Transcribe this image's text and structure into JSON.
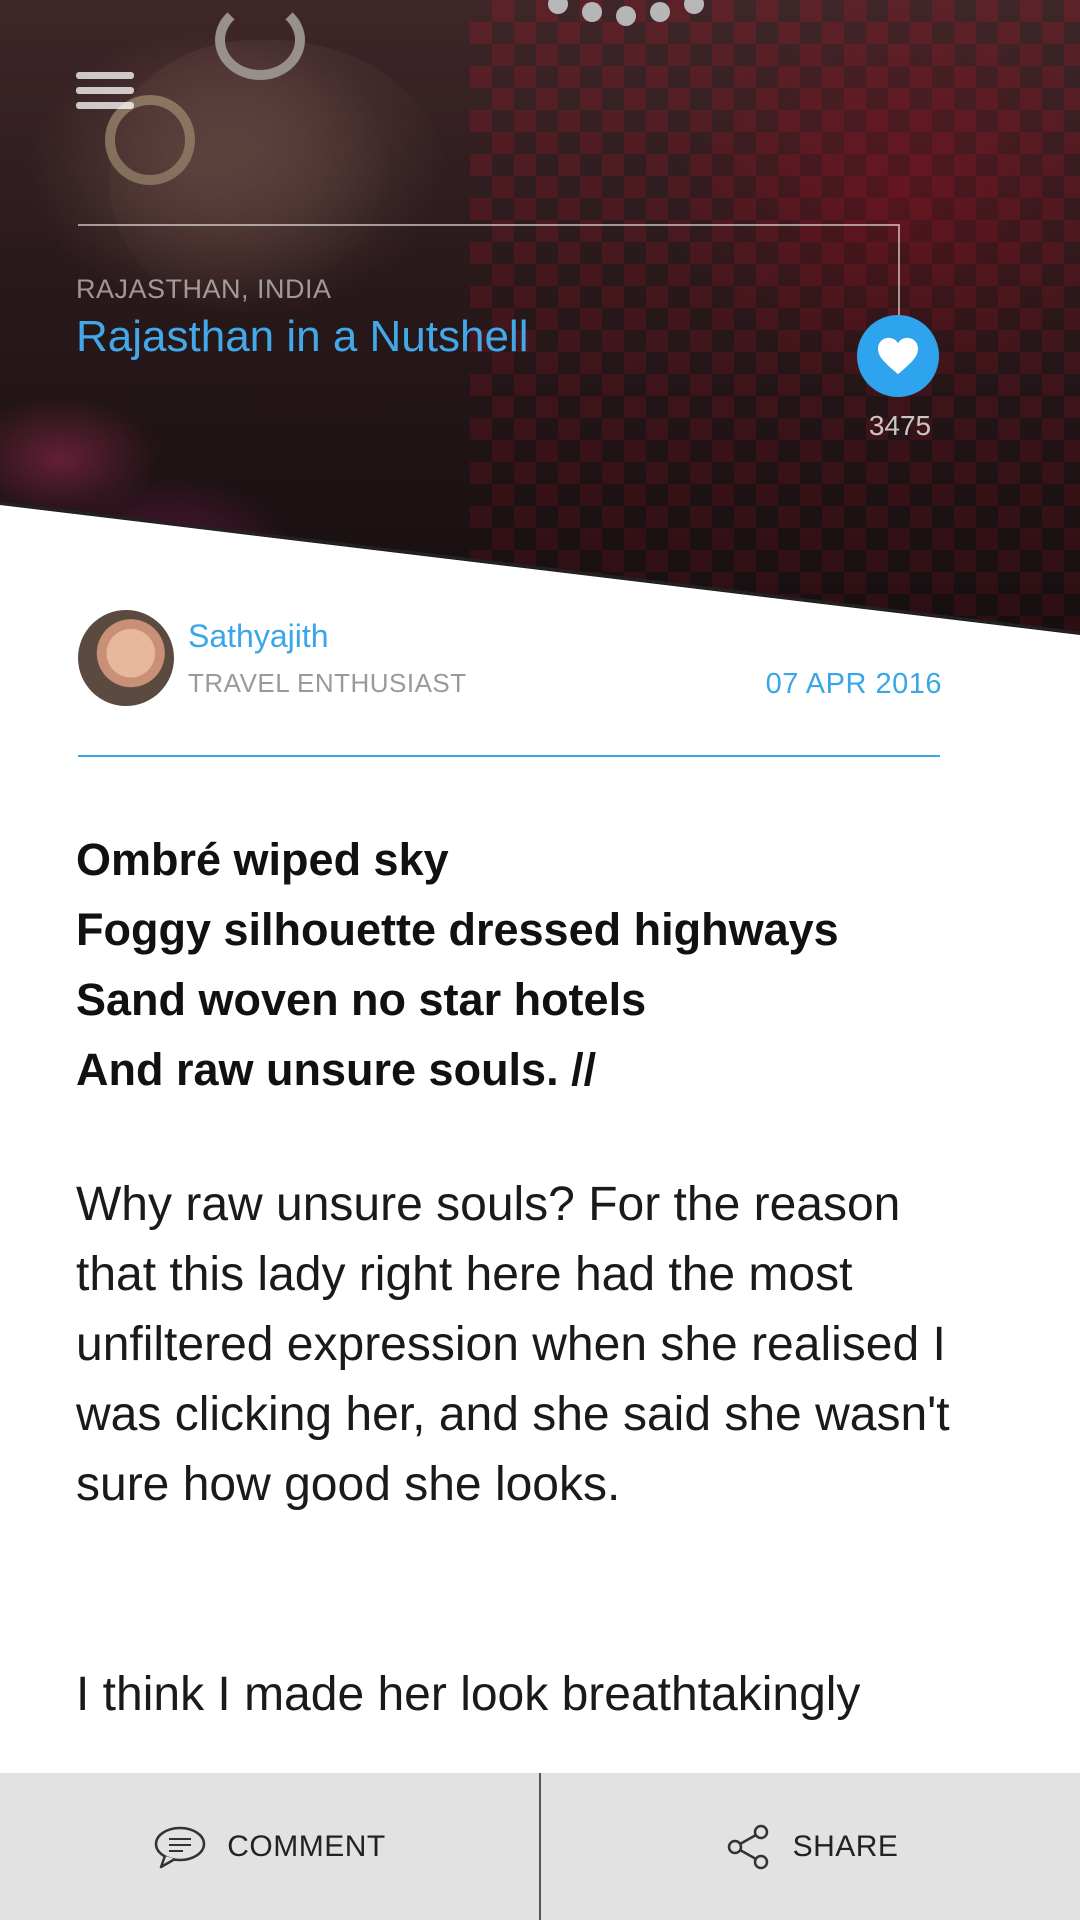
{
  "hero": {
    "location": "RAJASTHAN, INDIA",
    "title": "Rajasthan in a Nutshell",
    "likes": "3475"
  },
  "author": {
    "name": "Sathyajith",
    "role": "TRAVEL ENTHUSIAST",
    "date": "07 APR 2016"
  },
  "poem": [
    "Ombré wiped sky",
    "Foggy silhouette dressed highways",
    "Sand woven no star hotels",
    "And raw unsure souls. //"
  ],
  "paragraphs": [
    "Why raw unsure souls? For the reason that this lady right here had the most unfiltered expression when she realised I was clicking her, and she said she wasn't sure how good she looks.",
    "I think I made her look breathtakingly"
  ],
  "actions": {
    "comment": "COMMENT",
    "share": "SHARE"
  },
  "colors": {
    "accent": "#39a6e8",
    "bar": "#e2e2e2"
  },
  "icons": [
    "menu-icon",
    "heart-icon",
    "comment-icon",
    "share-icon"
  ]
}
